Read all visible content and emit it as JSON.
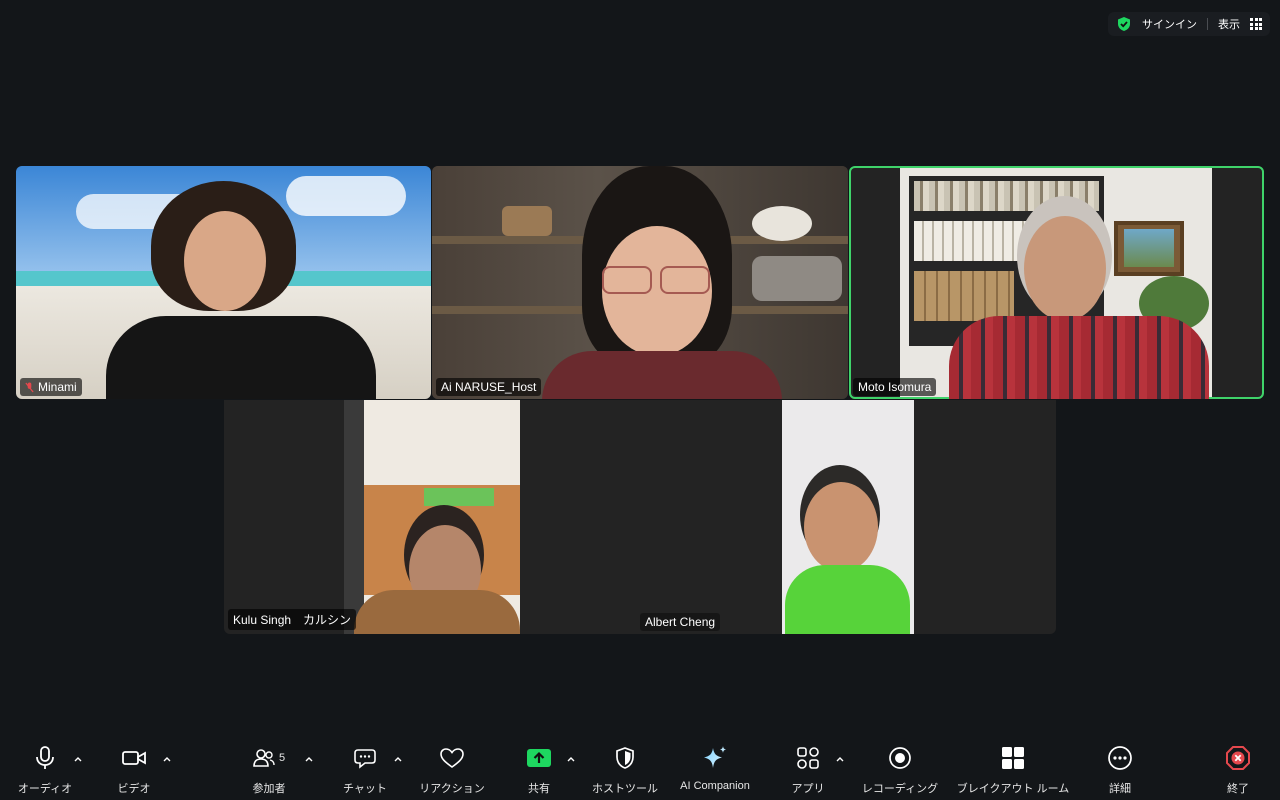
{
  "top": {
    "signin": "サインイン",
    "view": "表示"
  },
  "participants": {
    "minami": "Minami",
    "ai": "Ai NARUSE_Host",
    "moto": "Moto Isomura",
    "kulu": "Kulu Singh　カルシン",
    "albert": "Albert Cheng"
  },
  "toolbar": {
    "audio": "オーディオ",
    "video": "ビデオ",
    "participants": "参加者",
    "participants_count": "5",
    "chat": "チャット",
    "reactions": "リアクション",
    "share": "共有",
    "host_tools": "ホストツール",
    "ai_companion": "AI Companion",
    "apps": "アプリ",
    "recording": "レコーディング",
    "breakout": "ブレイクアウト ルーム",
    "more": "詳細",
    "end": "終了"
  },
  "colors": {
    "active_border": "#3fd36a",
    "share_green": "#1ed760",
    "end_red": "#e5484d",
    "background": "#131619"
  }
}
